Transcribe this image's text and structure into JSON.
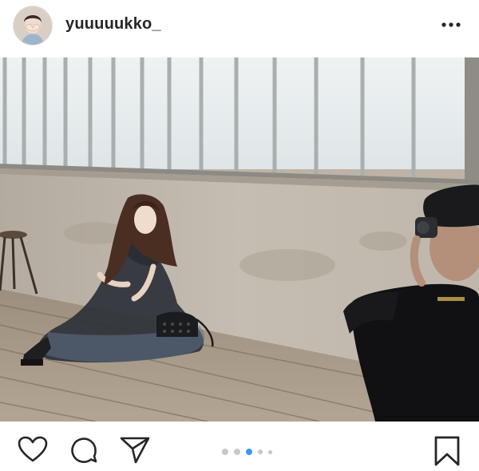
{
  "post": {
    "username": "yuuuuukko_"
  },
  "icons": {
    "avatar": "profile-avatar",
    "more": "more-options-icon",
    "like": "heart-icon",
    "comment": "comment-bubble-icon",
    "share": "paper-plane-icon",
    "save": "bookmark-icon"
  },
  "carousel": {
    "total": 5,
    "active_index": 2
  },
  "colors": {
    "text": "#262626",
    "active_dot": "#3897f0",
    "inactive_dot": "#c7c7c7"
  }
}
